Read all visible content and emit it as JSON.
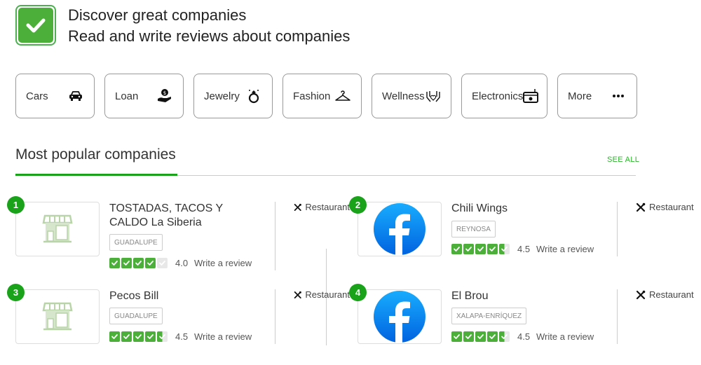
{
  "hero": {
    "line1": "Discover great companies",
    "line2": "Read and write reviews about companies",
    "logo_icon": "checkmark-icon",
    "brand_color": "#4caf3a"
  },
  "categories": [
    {
      "label": "Cars",
      "icon": "car-icon"
    },
    {
      "label": "Loan",
      "icon": "money-hand-icon"
    },
    {
      "label": "Jewelry",
      "icon": "ring-icon"
    },
    {
      "label": "Fashion",
      "icon": "hanger-icon"
    },
    {
      "label": "Wellness",
      "icon": "hands-heart-icon"
    },
    {
      "label": "Electronics",
      "icon": "radio-icon"
    },
    {
      "label": "More",
      "icon": "more-dots-icon"
    }
  ],
  "section": {
    "title": "Most popular companies",
    "see_all": "SEE ALL"
  },
  "companies": [
    {
      "rank": "1",
      "name": "TOSTADAS, TACOS Y CALDO La Siberia",
      "location": "GUADALUPE",
      "rating": "4.0",
      "rating_value": 4.0,
      "review_label": "Write a review",
      "category": "Restaurant",
      "thumb": "store-icon"
    },
    {
      "rank": "2",
      "name": "Chili Wings",
      "location": "REYNOSA",
      "rating": "4.5",
      "rating_value": 4.5,
      "review_label": "Write a review",
      "category": "Restaurant",
      "thumb": "facebook-logo"
    },
    {
      "rank": "3",
      "name": "Pecos Bill",
      "location": "GUADALUPE",
      "rating": "4.5",
      "rating_value": 4.5,
      "review_label": "Write a review",
      "category": "Restaurant",
      "thumb": "store-icon"
    },
    {
      "rank": "4",
      "name": "El Brou",
      "location": "XALAPA-ENRÍQUEZ",
      "rating": "4.5",
      "rating_value": 4.5,
      "review_label": "Write a review",
      "category": "Restaurant",
      "thumb": "facebook-logo"
    }
  ],
  "colors": {
    "accent": "#1aa31a",
    "star_on": "#4caf3a",
    "star_off": "#e8e8e8",
    "facebook": "#1877f2"
  }
}
